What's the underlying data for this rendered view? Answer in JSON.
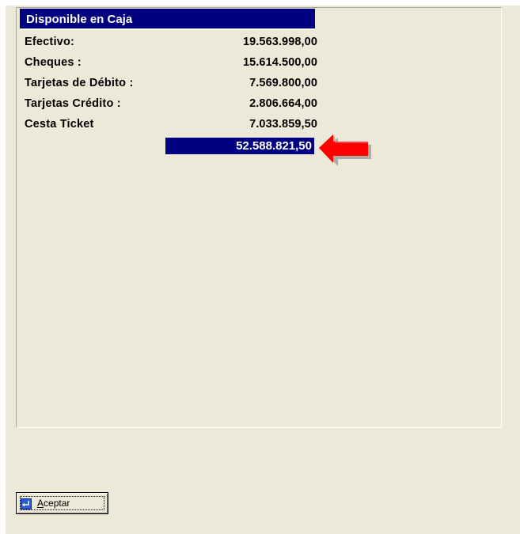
{
  "panel": {
    "title": "Disponible en Caja"
  },
  "rows": [
    {
      "label": "Efectivo:",
      "value": "19.563.998,00"
    },
    {
      "label": "Cheques :",
      "value": "15.614.500,00"
    },
    {
      "label": "Tarjetas de Débito :",
      "value": "7.569.800,00"
    },
    {
      "label": "Tarjetas Crédito :",
      "value": "2.806.664,00"
    },
    {
      "label": "Cesta Ticket",
      "value": "7.033.859,50"
    }
  ],
  "total": {
    "value": "52.588.821,50"
  },
  "arrow": {
    "icon": "red-arrow-left-icon",
    "color": "#ff0000"
  },
  "button": {
    "accept_mnemonic": "A",
    "accept_rest": "ceptar",
    "icon": "enter-icon"
  },
  "colors": {
    "header_bg": "#000080",
    "window_bg": "#ece9d8",
    "highlight_bg": "#000080"
  }
}
